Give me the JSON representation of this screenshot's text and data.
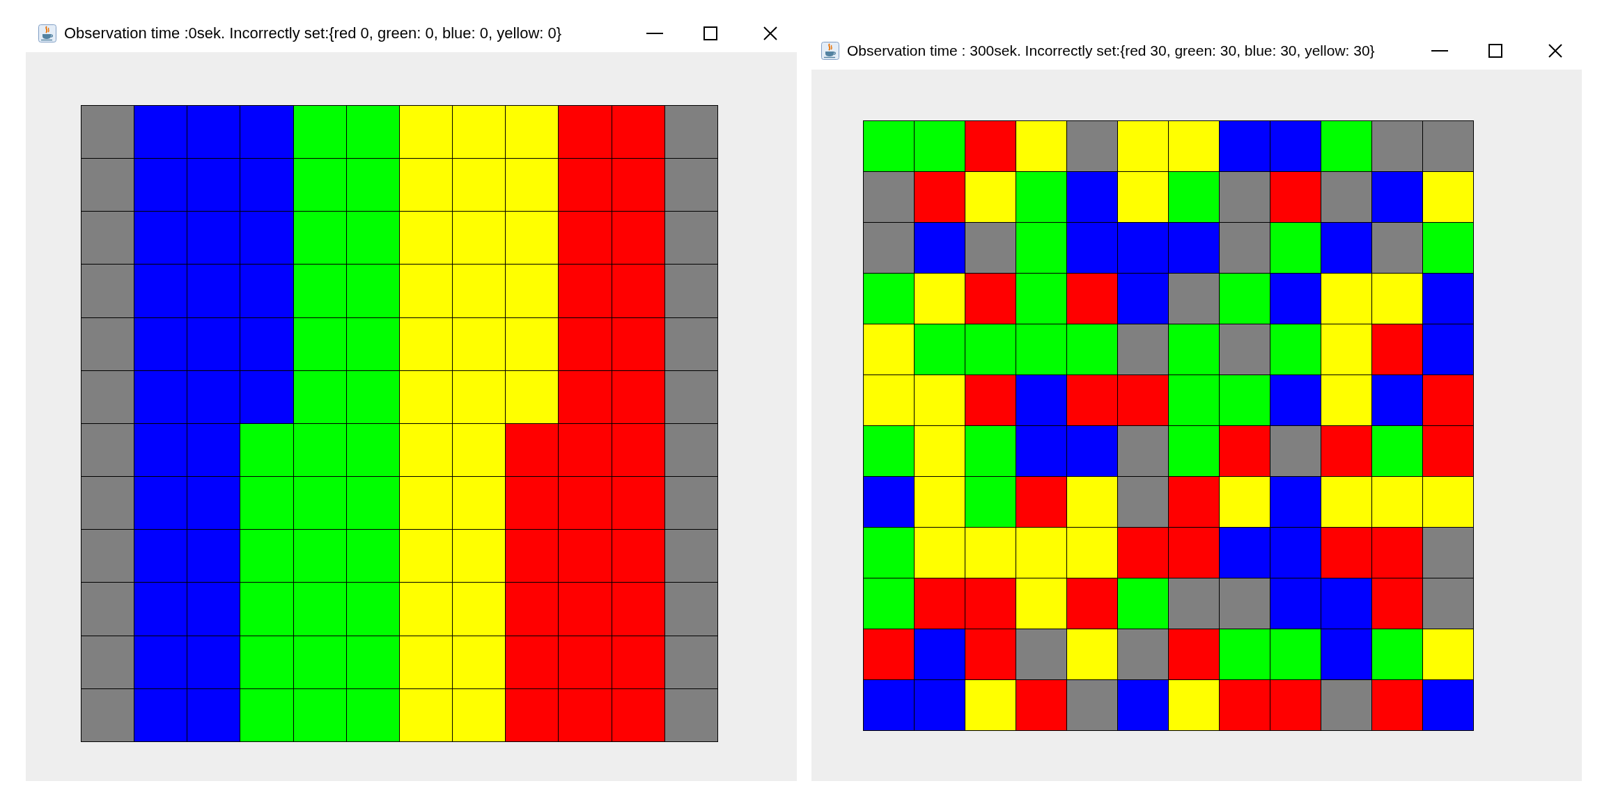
{
  "windows": [
    {
      "title": "Observation time :0sek. Incorrectly set:{red 0, green: 0, blue: 0, yellow: 0}",
      "grid": [
        [
          {
            "color": "#808080"
          },
          {
            "color": "#0000ff"
          },
          {
            "color": "#0000ff"
          },
          {
            "color": "#0000ff"
          },
          {
            "color": "#00ff00"
          },
          {
            "color": "#00ff00"
          },
          {
            "color": "#ffff00"
          },
          {
            "color": "#ffff00"
          },
          {
            "color": "#ffff00"
          },
          {
            "color": "#ff0000"
          },
          {
            "color": "#ff0000"
          },
          {
            "color": "#808080"
          }
        ],
        [
          {
            "color": "#808080"
          },
          {
            "color": "#0000ff"
          },
          {
            "color": "#0000ff"
          },
          {
            "color": "#0000ff"
          },
          {
            "color": "#00ff00"
          },
          {
            "color": "#00ff00"
          },
          {
            "color": "#ffff00"
          },
          {
            "color": "#ffff00"
          },
          {
            "color": "#ffff00"
          },
          {
            "color": "#ff0000"
          },
          {
            "color": "#ff0000"
          },
          {
            "color": "#808080"
          }
        ],
        [
          {
            "color": "#808080"
          },
          {
            "color": "#0000ff"
          },
          {
            "color": "#0000ff"
          },
          {
            "color": "#0000ff"
          },
          {
            "color": "#00ff00"
          },
          {
            "color": "#00ff00"
          },
          {
            "color": "#ffff00"
          },
          {
            "color": "#ffff00"
          },
          {
            "color": "#ffff00"
          },
          {
            "color": "#ff0000"
          },
          {
            "color": "#ff0000"
          },
          {
            "color": "#808080"
          }
        ],
        [
          {
            "color": "#808080"
          },
          {
            "color": "#0000ff"
          },
          {
            "color": "#0000ff"
          },
          {
            "color": "#0000ff"
          },
          {
            "color": "#00ff00"
          },
          {
            "color": "#00ff00"
          },
          {
            "color": "#ffff00"
          },
          {
            "color": "#ffff00"
          },
          {
            "color": "#ffff00"
          },
          {
            "color": "#ff0000"
          },
          {
            "color": "#ff0000"
          },
          {
            "color": "#808080"
          }
        ],
        [
          {
            "color": "#808080"
          },
          {
            "color": "#0000ff"
          },
          {
            "color": "#0000ff"
          },
          {
            "color": "#0000ff"
          },
          {
            "color": "#00ff00"
          },
          {
            "color": "#00ff00"
          },
          {
            "color": "#ffff00"
          },
          {
            "color": "#ffff00"
          },
          {
            "color": "#ffff00"
          },
          {
            "color": "#ff0000"
          },
          {
            "color": "#ff0000"
          },
          {
            "color": "#808080"
          }
        ],
        [
          {
            "color": "#808080"
          },
          {
            "color": "#0000ff"
          },
          {
            "color": "#0000ff"
          },
          {
            "color": "#0000ff"
          },
          {
            "color": "#00ff00"
          },
          {
            "color": "#00ff00"
          },
          {
            "color": "#ffff00"
          },
          {
            "color": "#ffff00"
          },
          {
            "color": "#ffff00"
          },
          {
            "color": "#ff0000"
          },
          {
            "color": "#ff0000"
          },
          {
            "color": "#808080"
          }
        ],
        [
          {
            "color": "#808080"
          },
          {
            "color": "#0000ff"
          },
          {
            "color": "#0000ff"
          },
          {
            "color": "#00ff00"
          },
          {
            "color": "#00ff00"
          },
          {
            "color": "#00ff00"
          },
          {
            "color": "#ffff00"
          },
          {
            "color": "#ffff00"
          },
          {
            "color": "#ff0000"
          },
          {
            "color": "#ff0000"
          },
          {
            "color": "#ff0000"
          },
          {
            "color": "#808080"
          }
        ],
        [
          {
            "color": "#808080"
          },
          {
            "color": "#0000ff"
          },
          {
            "color": "#0000ff"
          },
          {
            "color": "#00ff00"
          },
          {
            "color": "#00ff00"
          },
          {
            "color": "#00ff00"
          },
          {
            "color": "#ffff00"
          },
          {
            "color": "#ffff00"
          },
          {
            "color": "#ff0000"
          },
          {
            "color": "#ff0000"
          },
          {
            "color": "#ff0000"
          },
          {
            "color": "#808080"
          }
        ],
        [
          {
            "color": "#808080"
          },
          {
            "color": "#0000ff"
          },
          {
            "color": "#0000ff"
          },
          {
            "color": "#00ff00"
          },
          {
            "color": "#00ff00"
          },
          {
            "color": "#00ff00"
          },
          {
            "color": "#ffff00"
          },
          {
            "color": "#ffff00"
          },
          {
            "color": "#ff0000"
          },
          {
            "color": "#ff0000"
          },
          {
            "color": "#ff0000"
          },
          {
            "color": "#808080"
          }
        ],
        [
          {
            "color": "#808080"
          },
          {
            "color": "#0000ff"
          },
          {
            "color": "#0000ff"
          },
          {
            "color": "#00ff00"
          },
          {
            "color": "#00ff00"
          },
          {
            "color": "#00ff00"
          },
          {
            "color": "#ffff00"
          },
          {
            "color": "#ffff00"
          },
          {
            "color": "#ff0000"
          },
          {
            "color": "#ff0000"
          },
          {
            "color": "#ff0000"
          },
          {
            "color": "#808080"
          }
        ],
        [
          {
            "color": "#808080"
          },
          {
            "color": "#0000ff"
          },
          {
            "color": "#0000ff"
          },
          {
            "color": "#00ff00"
          },
          {
            "color": "#00ff00"
          },
          {
            "color": "#00ff00"
          },
          {
            "color": "#ffff00"
          },
          {
            "color": "#ffff00"
          },
          {
            "color": "#ff0000"
          },
          {
            "color": "#ff0000"
          },
          {
            "color": "#ff0000"
          },
          {
            "color": "#808080"
          }
        ],
        [
          {
            "color": "#808080"
          },
          {
            "color": "#0000ff"
          },
          {
            "color": "#0000ff"
          },
          {
            "color": "#00ff00"
          },
          {
            "color": "#00ff00"
          },
          {
            "color": "#00ff00"
          },
          {
            "color": "#ffff00"
          },
          {
            "color": "#ffff00"
          },
          {
            "color": "#ff0000"
          },
          {
            "color": "#ff0000"
          },
          {
            "color": "#ff0000"
          },
          {
            "color": "#808080"
          }
        ]
      ]
    },
    {
      "title": "Observation time : 300sek. Incorrectly set:{red 30, green: 30, blue: 30, yellow: 30}",
      "grid": [
        [
          {
            "color": "#00ff00"
          },
          {
            "color": "#00ff00"
          },
          {
            "color": "#ff0000"
          },
          {
            "color": "#ffff00"
          },
          {
            "color": "#808080"
          },
          {
            "color": "#ffff00"
          },
          {
            "color": "#ffff00"
          },
          {
            "color": "#0000ff"
          },
          {
            "color": "#0000ff"
          },
          {
            "color": "#00ff00"
          },
          {
            "color": "#808080"
          },
          {
            "color": "#808080"
          }
        ],
        [
          {
            "color": "#808080"
          },
          {
            "color": "#ff0000"
          },
          {
            "color": "#ffff00"
          },
          {
            "color": "#00ff00"
          },
          {
            "color": "#0000ff"
          },
          {
            "color": "#ffff00"
          },
          {
            "color": "#00ff00"
          },
          {
            "color": "#808080"
          },
          {
            "color": "#ff0000"
          },
          {
            "color": "#808080"
          },
          {
            "color": "#0000ff"
          },
          {
            "color": "#ffff00"
          }
        ],
        [
          {
            "color": "#808080"
          },
          {
            "color": "#0000ff"
          },
          {
            "color": "#808080"
          },
          {
            "color": "#00ff00"
          },
          {
            "color": "#0000ff"
          },
          {
            "color": "#0000ff"
          },
          {
            "color": "#0000ff"
          },
          {
            "color": "#808080"
          },
          {
            "color": "#00ff00"
          },
          {
            "color": "#0000ff"
          },
          {
            "color": "#808080"
          },
          {
            "color": "#00ff00"
          }
        ],
        [
          {
            "color": "#00ff00"
          },
          {
            "color": "#ffff00"
          },
          {
            "color": "#ff0000"
          },
          {
            "color": "#00ff00"
          },
          {
            "color": "#ff0000"
          },
          {
            "color": "#0000ff"
          },
          {
            "color": "#808080"
          },
          {
            "color": "#00ff00"
          },
          {
            "color": "#0000ff"
          },
          {
            "color": "#ffff00"
          },
          {
            "color": "#ffff00"
          },
          {
            "color": "#0000ff"
          }
        ],
        [
          {
            "color": "#ffff00"
          },
          {
            "color": "#00ff00"
          },
          {
            "color": "#00ff00"
          },
          {
            "color": "#00ff00"
          },
          {
            "color": "#00ff00"
          },
          {
            "color": "#808080"
          },
          {
            "color": "#00ff00"
          },
          {
            "color": "#808080"
          },
          {
            "color": "#00ff00"
          },
          {
            "color": "#ffff00"
          },
          {
            "color": "#ff0000"
          },
          {
            "color": "#0000ff"
          }
        ],
        [
          {
            "color": "#ffff00"
          },
          {
            "color": "#ffff00"
          },
          {
            "color": "#ff0000"
          },
          {
            "color": "#0000ff"
          },
          {
            "color": "#ff0000"
          },
          {
            "color": "#ff0000"
          },
          {
            "color": "#00ff00"
          },
          {
            "color": "#00ff00"
          },
          {
            "color": "#0000ff"
          },
          {
            "color": "#ffff00"
          },
          {
            "color": "#0000ff"
          },
          {
            "color": "#ff0000"
          }
        ],
        [
          {
            "color": "#00ff00"
          },
          {
            "color": "#ffff00"
          },
          {
            "color": "#00ff00"
          },
          {
            "color": "#0000ff"
          },
          {
            "color": "#0000ff"
          },
          {
            "color": "#808080"
          },
          {
            "color": "#00ff00"
          },
          {
            "color": "#ff0000"
          },
          {
            "color": "#808080"
          },
          {
            "color": "#ff0000"
          },
          {
            "color": "#00ff00"
          },
          {
            "color": "#ff0000"
          }
        ],
        [
          {
            "color": "#0000ff"
          },
          {
            "color": "#ffff00"
          },
          {
            "color": "#00ff00"
          },
          {
            "color": "#ff0000"
          },
          {
            "color": "#ffff00"
          },
          {
            "color": "#808080"
          },
          {
            "color": "#ff0000"
          },
          {
            "color": "#ffff00"
          },
          {
            "color": "#0000ff"
          },
          {
            "color": "#ffff00"
          },
          {
            "color": "#ffff00"
          },
          {
            "color": "#ffff00"
          }
        ],
        [
          {
            "color": "#00ff00"
          },
          {
            "color": "#ffff00"
          },
          {
            "color": "#ffff00"
          },
          {
            "color": "#ffff00"
          },
          {
            "color": "#ffff00"
          },
          {
            "color": "#ff0000"
          },
          {
            "color": "#ff0000"
          },
          {
            "color": "#0000ff"
          },
          {
            "color": "#0000ff"
          },
          {
            "color": "#ff0000"
          },
          {
            "color": "#ff0000"
          },
          {
            "color": "#808080"
          }
        ],
        [
          {
            "color": "#00ff00"
          },
          {
            "color": "#ff0000"
          },
          {
            "color": "#ff0000"
          },
          {
            "color": "#ffff00"
          },
          {
            "color": "#ff0000"
          },
          {
            "color": "#00ff00"
          },
          {
            "color": "#808080"
          },
          {
            "color": "#808080"
          },
          {
            "color": "#0000ff"
          },
          {
            "color": "#0000ff"
          },
          {
            "color": "#ff0000"
          },
          {
            "color": "#808080"
          }
        ],
        [
          {
            "color": "#ff0000"
          },
          {
            "color": "#0000ff"
          },
          {
            "color": "#ff0000"
          },
          {
            "color": "#808080"
          },
          {
            "color": "#ffff00"
          },
          {
            "color": "#808080"
          },
          {
            "color": "#ff0000"
          },
          {
            "color": "#00ff00"
          },
          {
            "color": "#00ff00"
          },
          {
            "color": "#0000ff"
          },
          {
            "color": "#00ff00"
          },
          {
            "color": "#ffff00"
          }
        ],
        [
          {
            "color": "#0000ff"
          },
          {
            "color": "#0000ff"
          },
          {
            "color": "#ffff00"
          },
          {
            "color": "#ff0000"
          },
          {
            "color": "#808080"
          },
          {
            "color": "#0000ff"
          },
          {
            "color": "#ffff00"
          },
          {
            "color": "#ff0000"
          },
          {
            "color": "#ff0000"
          },
          {
            "color": "#808080"
          },
          {
            "color": "#ff0000"
          },
          {
            "color": "#0000ff"
          }
        ]
      ]
    }
  ]
}
